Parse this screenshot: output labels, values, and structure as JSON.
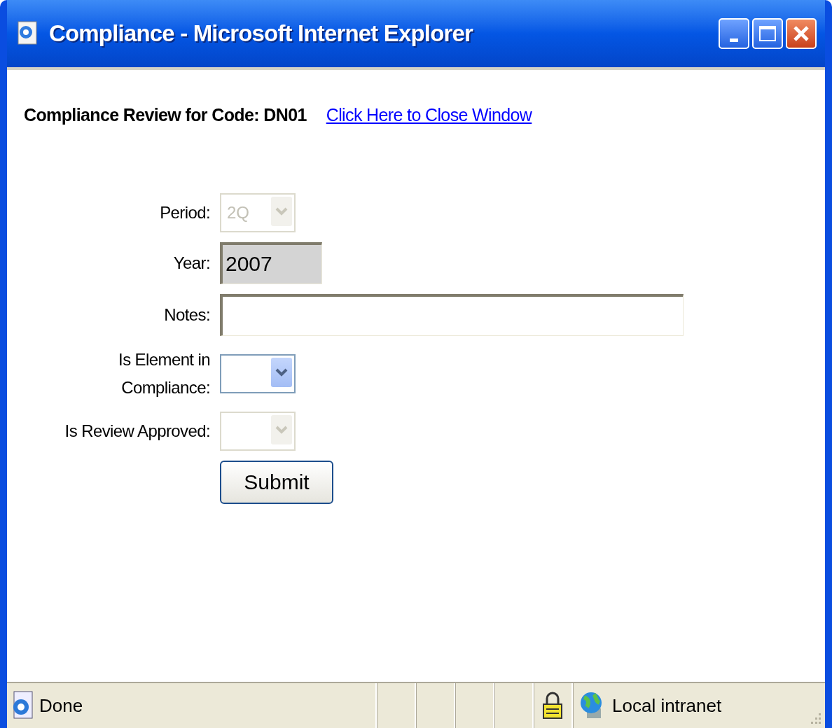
{
  "window": {
    "title": "Compliance - Microsoft Internet Explorer"
  },
  "heading": "Compliance Review for Code: DN01",
  "close_link": "Click Here to Close Window",
  "fields": [
    {
      "kind": "select",
      "label": "Period:",
      "value": "2Q",
      "disabled": true
    },
    {
      "kind": "text",
      "label": "Year:",
      "value": "2007",
      "readonly": true
    },
    {
      "kind": "text",
      "label": "Notes:",
      "readonly": false
    },
    {
      "kind": "select",
      "label": "Is Element in Compliance:",
      "disabled": false
    },
    {
      "kind": "select",
      "label": "Is Review Approved:",
      "disabled": true
    }
  ],
  "submit": "Submit",
  "status_bar": {
    "text": "Done",
    "zone": "Local intranet"
  }
}
